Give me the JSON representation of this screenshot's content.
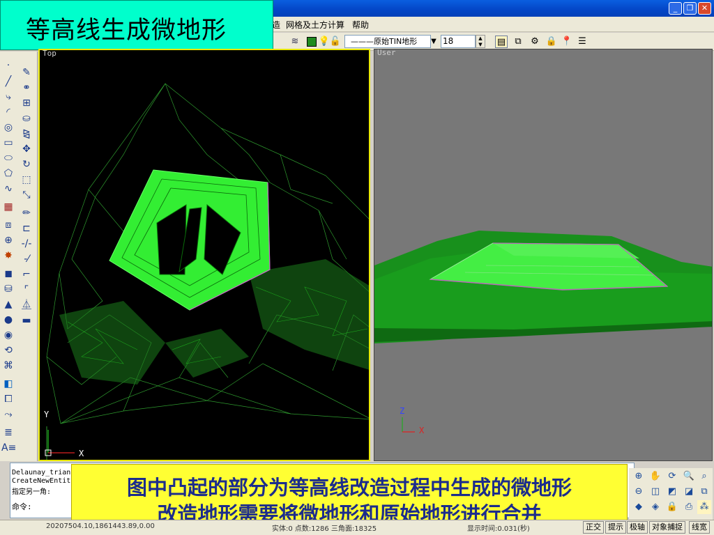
{
  "title_banner": "等高线生成微地形",
  "menu": {
    "items": [
      {
        "id": "m-partial",
        "label": "造"
      },
      {
        "id": "m-grid",
        "label": "网格及土方计算"
      },
      {
        "id": "m-help",
        "label": "帮助"
      }
    ]
  },
  "toolbar": {
    "layer_name": "———原始TIN地形",
    "value": "18",
    "icons": [
      "layers-icon",
      "lightbulb-icon",
      "lock-icon",
      "layer-props-icon",
      "layer-merge-icon",
      "layer-tree-icon",
      "padlock-icon",
      "pin-icon",
      "layer-stack-icon"
    ]
  },
  "viewports": {
    "left": {
      "label": "Top",
      "axis_y": "Y",
      "axis_x": "X"
    },
    "right": {
      "label": "User",
      "axis_z": "Z",
      "axis_x": "X"
    }
  },
  "command": {
    "lines": [
      "Delaunay_trian",
      "CreateNewEntit",
      "指定另一角:"
    ],
    "prompt": "命令:"
  },
  "caption": {
    "line1": "图中凸起的部分为等高线改造过程中生成的微地形",
    "line2": "改造地形需要将微地形和原始地形进行合并"
  },
  "status": {
    "coords": "20207504.10,1861443.89,0.00",
    "entity_info": "实体:0 点数:1286 三角面:18325",
    "timing": "显示时间:0.031(秒)",
    "buttons": [
      "正交",
      "提示",
      "极轴",
      "对象捕捉",
      "线宽"
    ]
  },
  "colors": {
    "title_banner_bg": "#00ffcc",
    "caption_bg": "#ffff33",
    "caption_text": "#1c2c8c",
    "terrain_green": "#1a9a1a",
    "micro_terrain": "#33ee33"
  }
}
